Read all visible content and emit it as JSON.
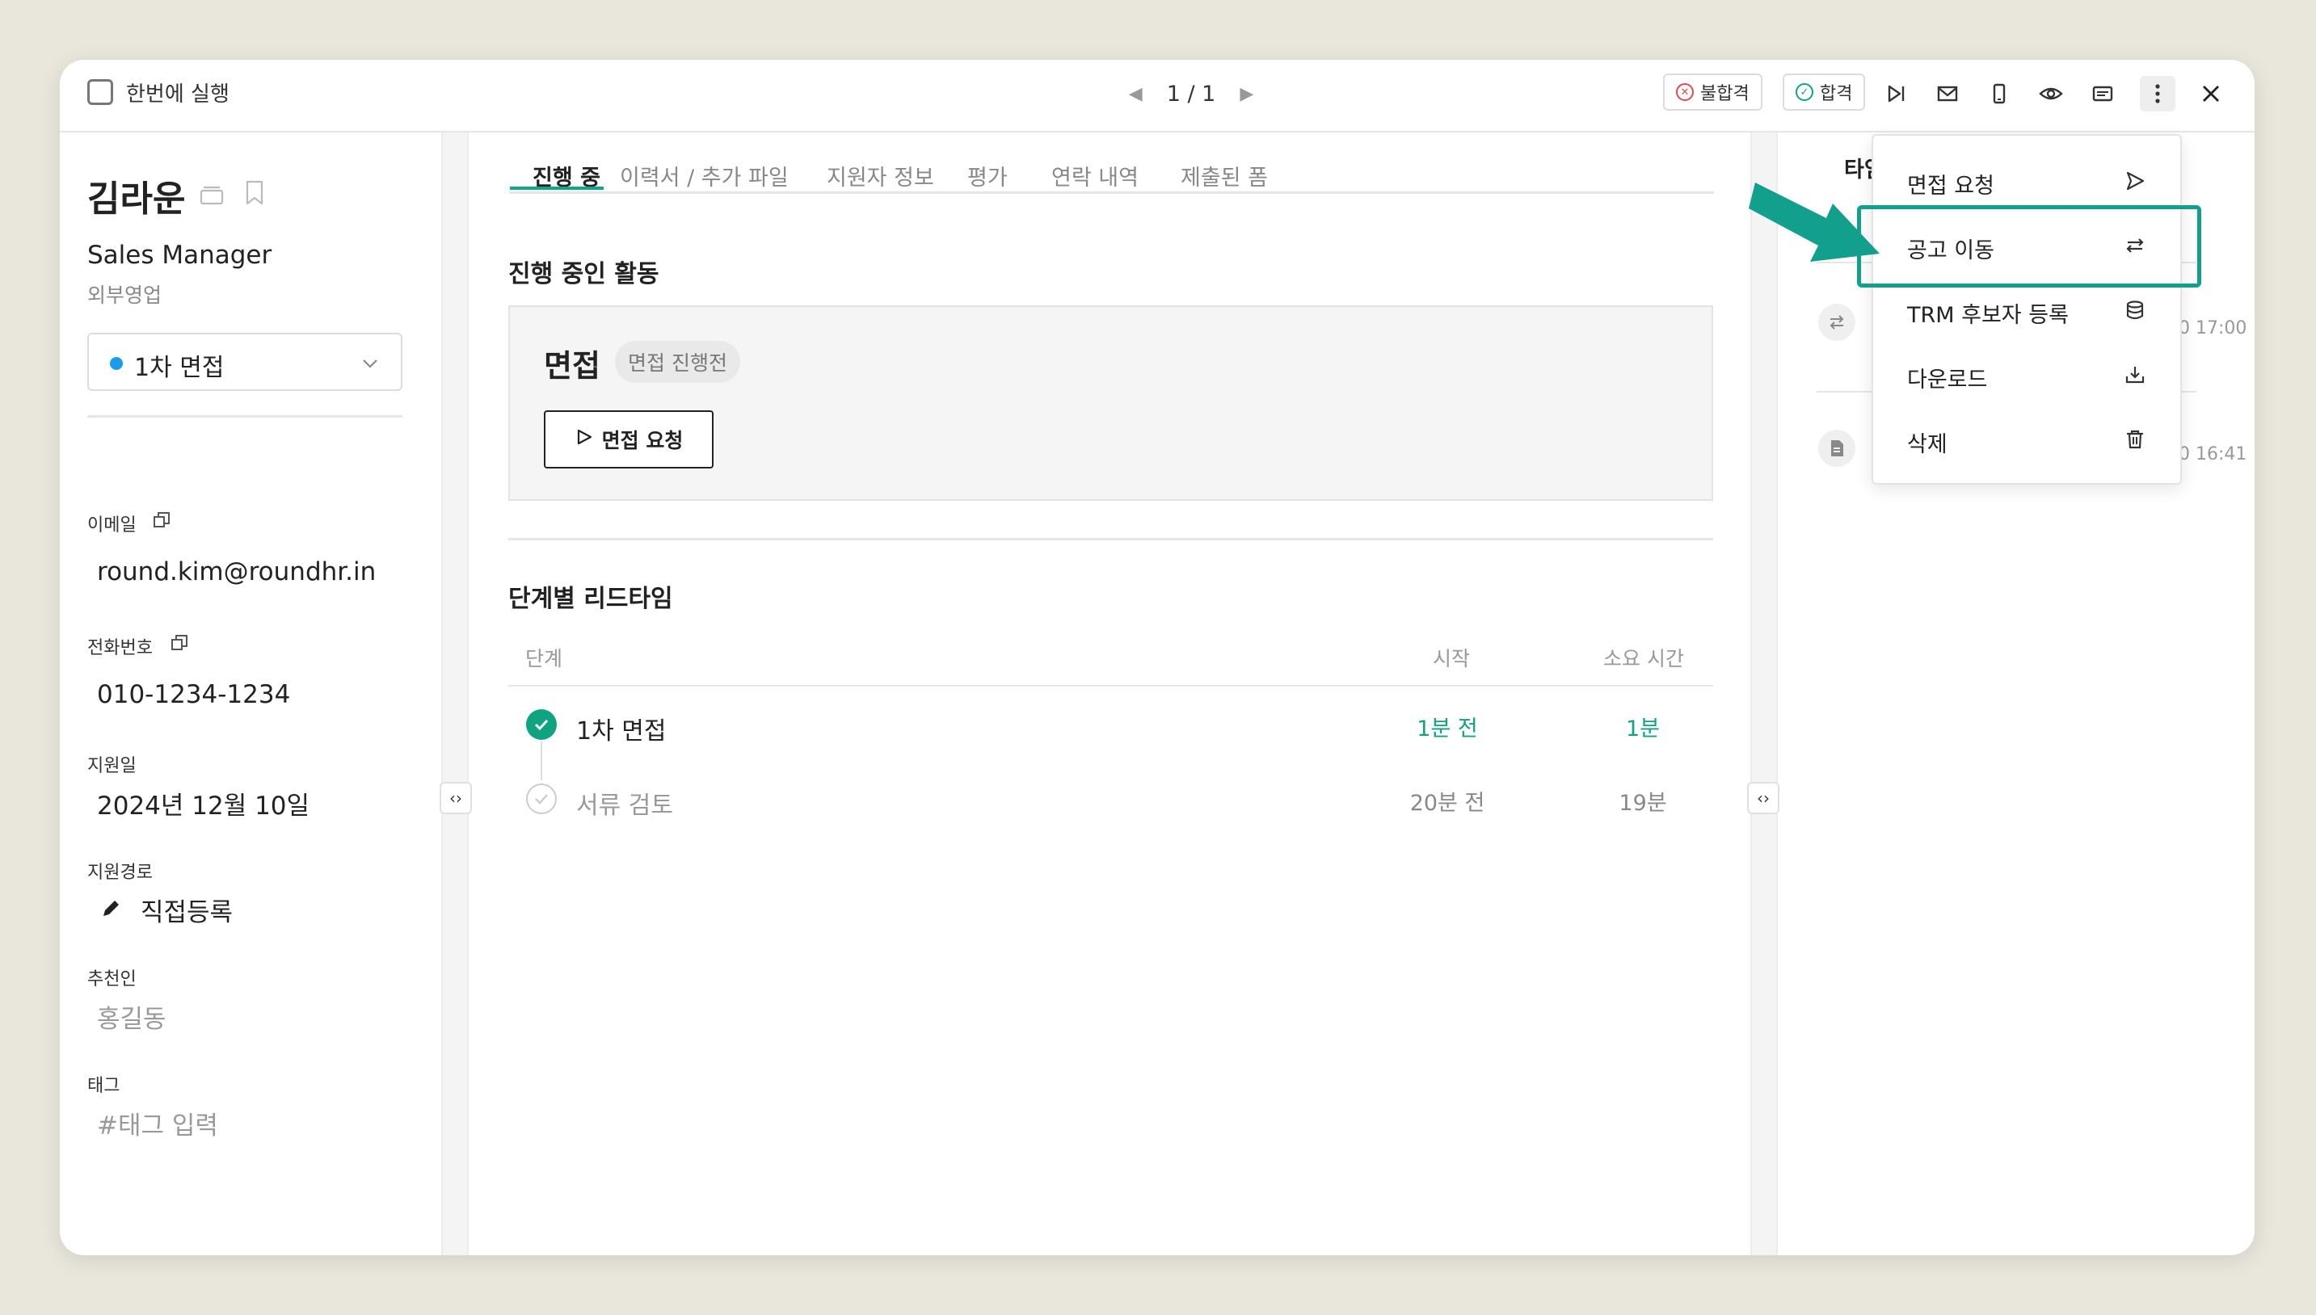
{
  "topbar": {
    "run_all_label": "한번에 실행",
    "pager": "1 / 1",
    "fail_label": "불합격",
    "pass_label": "합격"
  },
  "candidate": {
    "name": "김라운",
    "role": "Sales Manager",
    "department": "외부영업",
    "stage": "1차 면접",
    "stage_color": "#1A9BEB",
    "fields": {
      "email_label": "이메일",
      "email": "round.kim@roundhr.in",
      "phone_label": "전화번호",
      "phone": "010-1234-1234",
      "applied_label": "지원일",
      "applied": "2024년 12월 10일",
      "source_label": "지원경로",
      "source": "직접등록",
      "referrer_label": "추천인",
      "referrer": "홍길동",
      "tags_label": "태그",
      "tags_placeholder": "#태그 입력"
    }
  },
  "tabs": [
    "진행 중",
    "이력서 / 추가 파일",
    "지원자 정보",
    "평가",
    "연락 내역",
    "제출된 폼"
  ],
  "activity": {
    "section_title": "진행 중인 활동",
    "title": "면접",
    "badge": "면접 진행전",
    "button_label": "면접 요청"
  },
  "leadtime": {
    "section_title": "단계별 리드타임",
    "headers": {
      "stage": "단계",
      "start": "시작",
      "duration": "소요 시간"
    },
    "rows": [
      {
        "stage": "1차 면접",
        "start": "1분 전",
        "duration": "1분",
        "done": true
      },
      {
        "stage": "서류 검토",
        "start": "20분 전",
        "duration": "19분",
        "done": false
      }
    ]
  },
  "right_panel": {
    "title": "타임",
    "events": [
      {
        "time": "0 17:00",
        "icon": "swap-icon"
      },
      {
        "time": "0 16:41",
        "icon": "document-icon"
      }
    ]
  },
  "menu": {
    "items": [
      {
        "label": "면접 요청",
        "icon": "send-icon"
      },
      {
        "label": "공고 이동",
        "icon": "swap-icon"
      },
      {
        "label": "TRM 후보자 등록",
        "icon": "database-icon"
      },
      {
        "label": "다운로드",
        "icon": "download-icon"
      },
      {
        "label": "삭제",
        "icon": "trash-icon"
      }
    ],
    "highlight_color": "#12A08C"
  }
}
